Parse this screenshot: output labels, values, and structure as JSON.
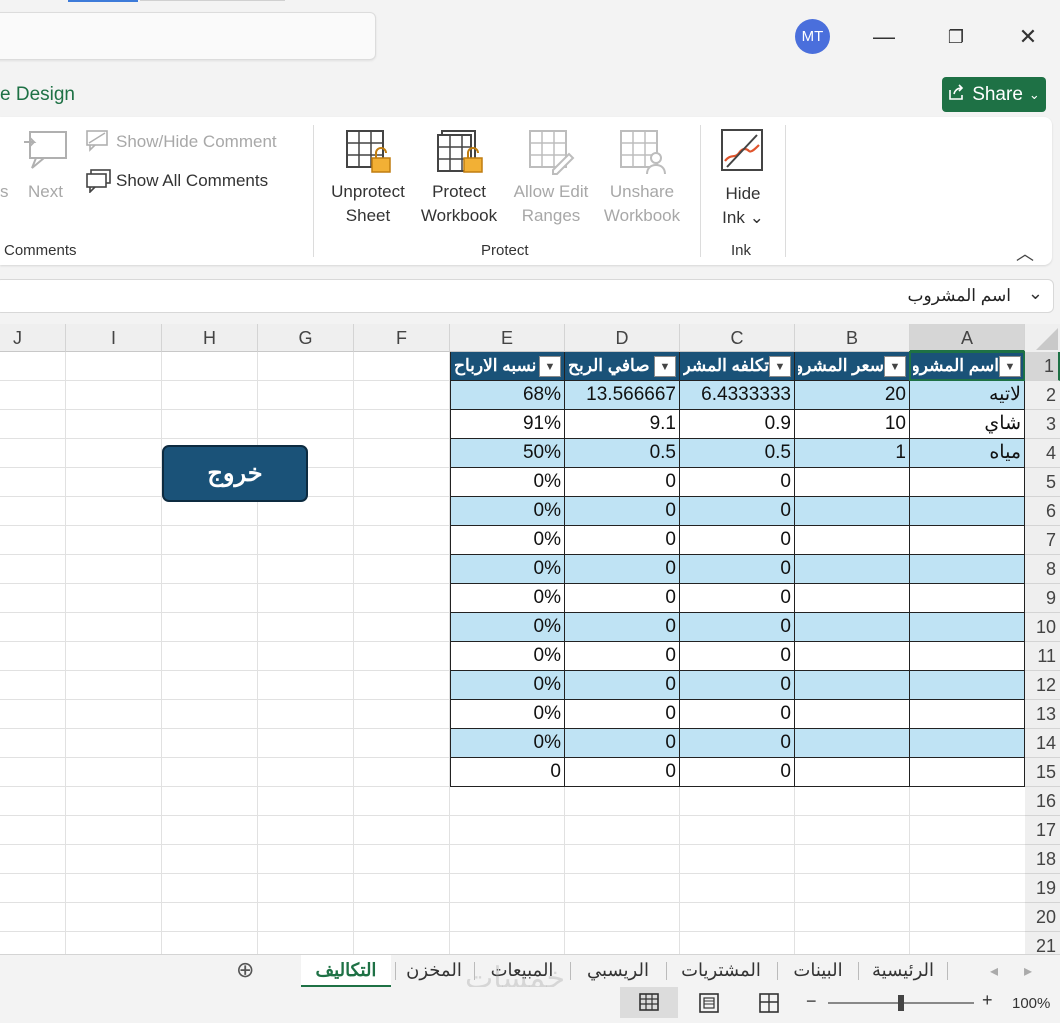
{
  "titlebar": {
    "avatar_initials": "MT",
    "minimize_glyph": "—",
    "restore_glyph": "❐",
    "close_glyph": "✕"
  },
  "ribbon": {
    "active_tab_partial": "e Design",
    "share_label": "Share",
    "comments": {
      "prev_partial": "s",
      "next_label": "Next",
      "show_hide_label": "Show/Hide Comment",
      "show_all_label": "Show All Comments",
      "group_label": "Comments"
    },
    "protect": {
      "unprotect_sheet": [
        "Unprotect",
        "Sheet"
      ],
      "protect_workbook": [
        "Protect",
        "Workbook"
      ],
      "allow_edit": [
        "Allow Edit",
        "Ranges"
      ],
      "unshare": [
        "Unshare",
        "Workbook"
      ],
      "group_label": "Protect"
    },
    "ink": {
      "hide_ink": [
        "Hide",
        "Ink ⌄"
      ],
      "group_label": "Ink"
    }
  },
  "formula_bar": {
    "value": "اسم المشروب"
  },
  "grid": {
    "columns": [
      "A",
      "B",
      "C",
      "D",
      "E",
      "F",
      "G",
      "H",
      "I",
      "J"
    ],
    "rows": [
      "1",
      "2",
      "3",
      "4",
      "5",
      "6",
      "7",
      "8",
      "9",
      "10",
      "11",
      "12",
      "13",
      "14",
      "15",
      "16",
      "17",
      "18",
      "19",
      "20",
      "21"
    ],
    "headers": [
      "اسم المشروب",
      "سعر المشروب",
      "تكلفه المشروب",
      "صافي الربح",
      "نسبه الارباح"
    ],
    "data": [
      [
        "لاتيه",
        "20",
        "6.4333333",
        "13.566667",
        "68%"
      ],
      [
        "شاي",
        "10",
        "0.9",
        "9.1",
        "91%"
      ],
      [
        "مياه",
        "1",
        "0.5",
        "0.5",
        "50%"
      ],
      [
        "",
        "",
        "0",
        "0",
        "0%"
      ],
      [
        "",
        "",
        "0",
        "0",
        "0%"
      ],
      [
        "",
        "",
        "0",
        "0",
        "0%"
      ],
      [
        "",
        "",
        "0",
        "0",
        "0%"
      ],
      [
        "",
        "",
        "0",
        "0",
        "0%"
      ],
      [
        "",
        "",
        "0",
        "0",
        "0%"
      ],
      [
        "",
        "",
        "0",
        "0",
        "0%"
      ],
      [
        "",
        "",
        "0",
        "0",
        "0%"
      ],
      [
        "",
        "",
        "0",
        "0",
        "0%"
      ],
      [
        "",
        "",
        "0",
        "0",
        "0%"
      ],
      [
        "",
        "",
        "0",
        "0",
        "0"
      ]
    ],
    "exit_button": "خروج"
  },
  "sheets": {
    "tabs": [
      "الرئيسية",
      "البينات",
      "المشتريات",
      "الريسبي",
      "المبيعات",
      "المخزن",
      "التكاليف"
    ],
    "active": "التكاليف",
    "add_glyph": "⊕",
    "nav_prev": "◂",
    "nav_next": "▸"
  },
  "status": {
    "zoom": "100%",
    "zoom_minus": "−",
    "zoom_plus": "+",
    "zoom_fraction": 0.5
  },
  "watermark": "خمسات"
}
